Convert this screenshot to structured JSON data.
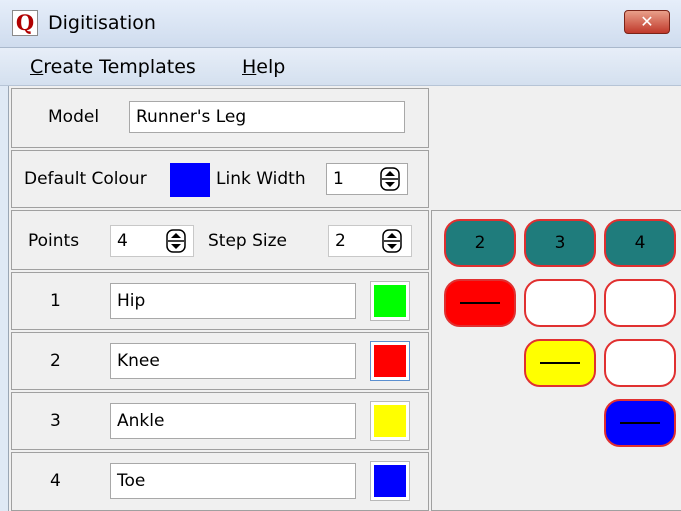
{
  "window": {
    "title": "Digitisation",
    "app_icon_letter": "Q",
    "close_glyph": "✕"
  },
  "menu": {
    "items": [
      {
        "underline": "C",
        "rest": "reate Templates"
      },
      {
        "underline": "H",
        "rest": "elp"
      }
    ]
  },
  "model": {
    "label": "Model",
    "value": "Runner's Leg"
  },
  "defaults": {
    "colour_label": "Default Colour",
    "colour": "#0000ff",
    "link_width_label": "Link Width",
    "link_width": "1"
  },
  "points": {
    "label": "Points",
    "count": "4",
    "step_label": "Step Size",
    "step": "2",
    "rows": [
      {
        "index": "1",
        "name": "Hip",
        "color": "#00ff00"
      },
      {
        "index": "2",
        "name": "Knee",
        "color": "#ff0000"
      },
      {
        "index": "3",
        "name": "Ankle",
        "color": "#ffff00"
      },
      {
        "index": "4",
        "name": "Toe",
        "color": "#0000ff"
      }
    ]
  },
  "matrix": {
    "headers": [
      "2",
      "3",
      "4"
    ],
    "header_color": "#1f7c7c",
    "border_color": "#e03030",
    "link_colors": {
      "1-2": "#ff0000",
      "2-3": "#ffff00",
      "3-4": "#0000ff"
    }
  }
}
